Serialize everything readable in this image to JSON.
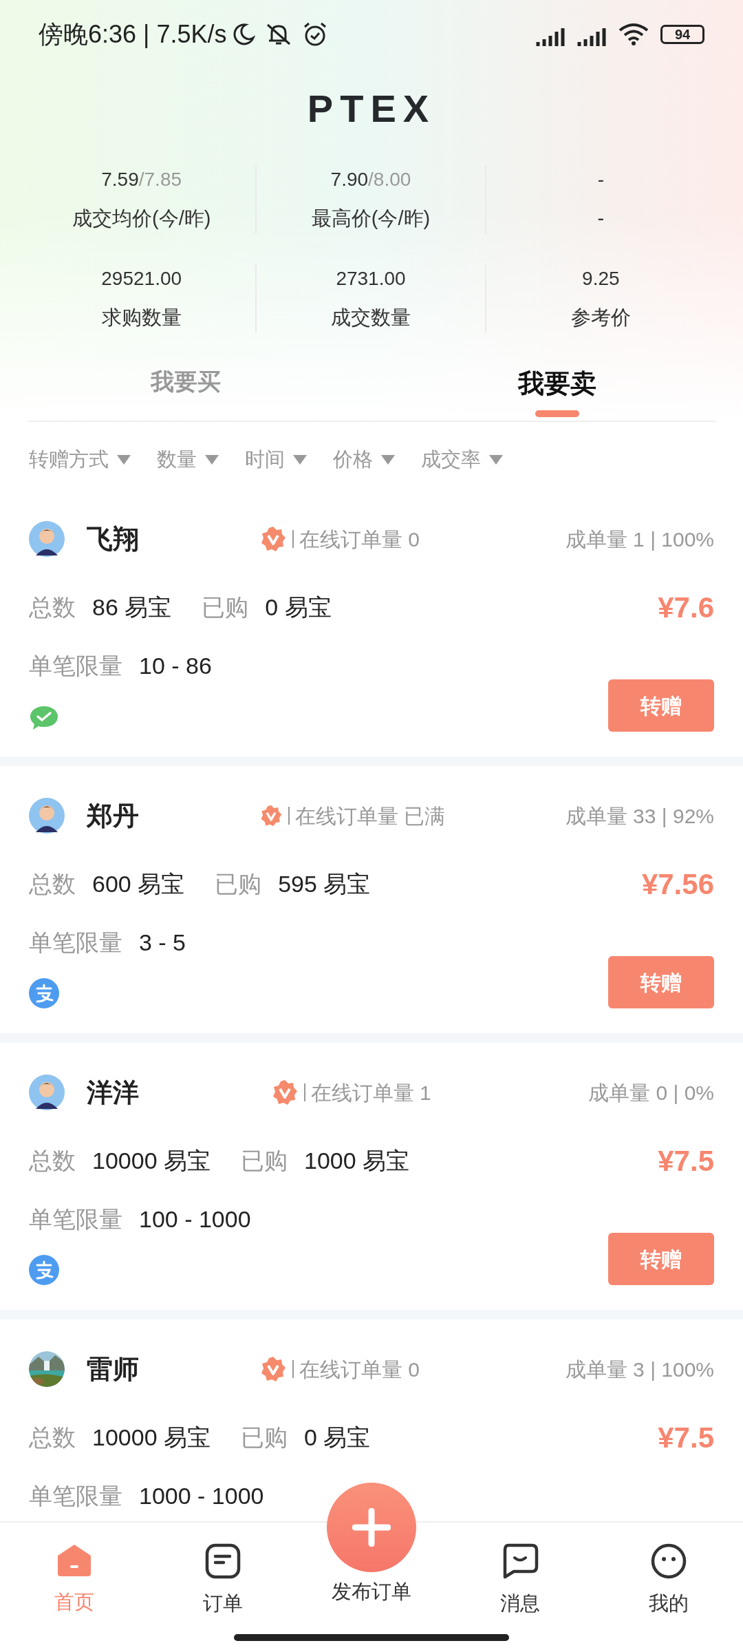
{
  "status_bar": {
    "time": "傍晚6:36 | 7.5K/s",
    "battery": "94"
  },
  "title": "PTEX",
  "stats": [
    {
      "value": "7.59",
      "previous": "/7.85",
      "label": "成交均价(今/昨)"
    },
    {
      "value": "7.90",
      "previous": "/8.00",
      "label": "最高价(今/昨)"
    },
    {
      "value": "-",
      "label": "-"
    },
    {
      "value": "29521.00",
      "label": "求购数量"
    },
    {
      "value": "2731.00",
      "label": "成交数量"
    },
    {
      "value": "9.25",
      "label": "参考价"
    }
  ],
  "tabs": [
    {
      "label": "我要买",
      "selected": false
    },
    {
      "label": "我要卖",
      "selected": true
    }
  ],
  "filters": [
    "转赠方式",
    "数量",
    "时间",
    "价格",
    "成交率"
  ],
  "listings": [
    {
      "name": "飞翔",
      "avatar": {
        "kind": "cartoon"
      },
      "online": "在线订单量 0",
      "completed": "成单量 1 | 100%",
      "total_label": "总数",
      "total": "86 易宝",
      "bought_label": "已购",
      "bought": "0 易宝",
      "price": "¥7.6",
      "limit_label": "单笔限量",
      "limit": "10 - 86",
      "payment": {
        "kind": "wechat"
      },
      "button": "转赠"
    },
    {
      "name": "郑丹",
      "avatar": {
        "kind": "cartoon"
      },
      "online": "在线订单量 已满",
      "completed": "成单量 33 | 92%",
      "total_label": "总数",
      "total": "600 易宝",
      "bought_label": "已购",
      "bought": "595 易宝",
      "price": "¥7.56",
      "limit_label": "单笔限量",
      "limit": "3 - 5",
      "payment": {
        "kind": "alipay"
      },
      "button": "转赠"
    },
    {
      "name": "洋洋",
      "avatar": {
        "kind": "cartoon"
      },
      "online": "在线订单量 1",
      "completed": "成单量 0 | 0%",
      "total_label": "总数",
      "total": "10000 易宝",
      "bought_label": "已购",
      "bought": "1000 易宝",
      "price": "¥7.5",
      "limit_label": "单笔限量",
      "limit": "100 - 1000",
      "payment": {
        "kind": "alipay"
      },
      "button": "转赠"
    },
    {
      "name": "雷师",
      "online": "在线订单量 0",
      "completed": "成单量 3 | 100%",
      "total_label": "总数",
      "total": "10000 易宝",
      "bought_label": "已购",
      "bought": "0 易宝",
      "price": "¥7.5",
      "limit_label": "单笔限量",
      "limit": "1000 - 1000"
    }
  ],
  "nav": [
    {
      "label": "首页",
      "kind": "home",
      "selected": true
    },
    {
      "label": "订单",
      "kind": "orders",
      "selected": false
    },
    {
      "label": "发布订单",
      "kind": "publish",
      "selected": false
    },
    {
      "label": "消息",
      "kind": "messages",
      "selected": false
    },
    {
      "label": "我的",
      "kind": "profile",
      "selected": false
    }
  ]
}
